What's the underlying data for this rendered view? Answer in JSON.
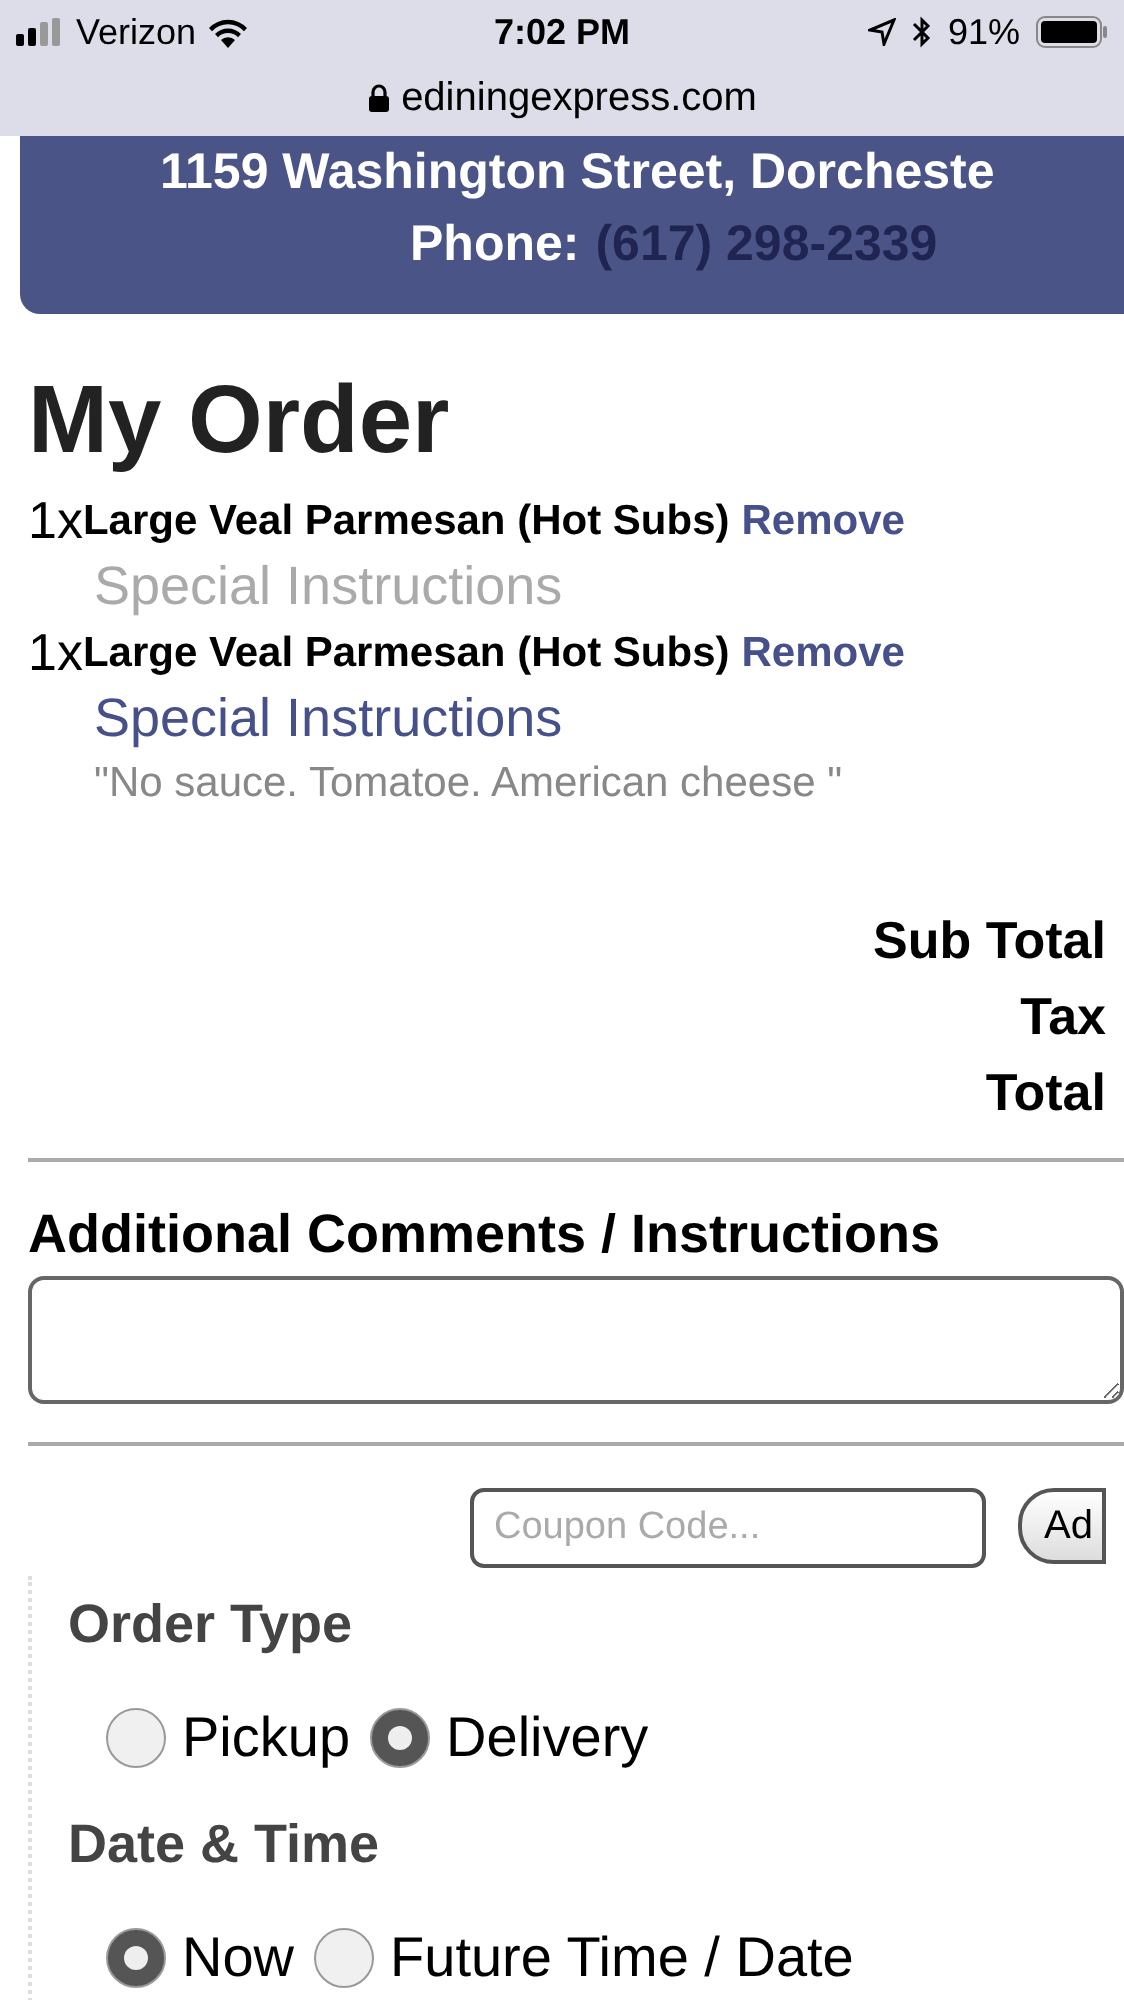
{
  "status_bar": {
    "carrier": "Verizon",
    "time": "7:02 PM",
    "battery": "91%"
  },
  "url_bar": {
    "url": "ediningexpress.com"
  },
  "header": {
    "address": "1159 Washington Street, Dorcheste",
    "phone_label": "Phone:",
    "phone": "(617) 298-2339"
  },
  "order": {
    "title": "My Order",
    "items": [
      {
        "quantity": "1x",
        "name": "Large Veal Parmesan (Hot Subs)",
        "remove": "Remove",
        "instructions_label": "Special Instructions",
        "has_instructions": false
      },
      {
        "quantity": "1x",
        "name": "Large Veal Parmesan (Hot Subs)",
        "remove": "Remove",
        "instructions_label": "Special Instructions",
        "has_instructions": true,
        "instructions": "\"No sauce. Tomatoe. American cheese \""
      }
    ],
    "totals": [
      "Sub Total",
      "Tax",
      "Total"
    ]
  },
  "comments": {
    "title": "Additional Comments / Instructions"
  },
  "coupon": {
    "placeholder": "Coupon Code...",
    "button": "Ad"
  },
  "order_type": {
    "title": "Order Type",
    "options": [
      {
        "label": "Pickup",
        "selected": false
      },
      {
        "label": "Delivery",
        "selected": true
      }
    ]
  },
  "date_time": {
    "title": "Date & Time",
    "options": [
      {
        "label": "Now",
        "selected": true
      },
      {
        "label": "Future Time / Date",
        "selected": false
      }
    ]
  }
}
